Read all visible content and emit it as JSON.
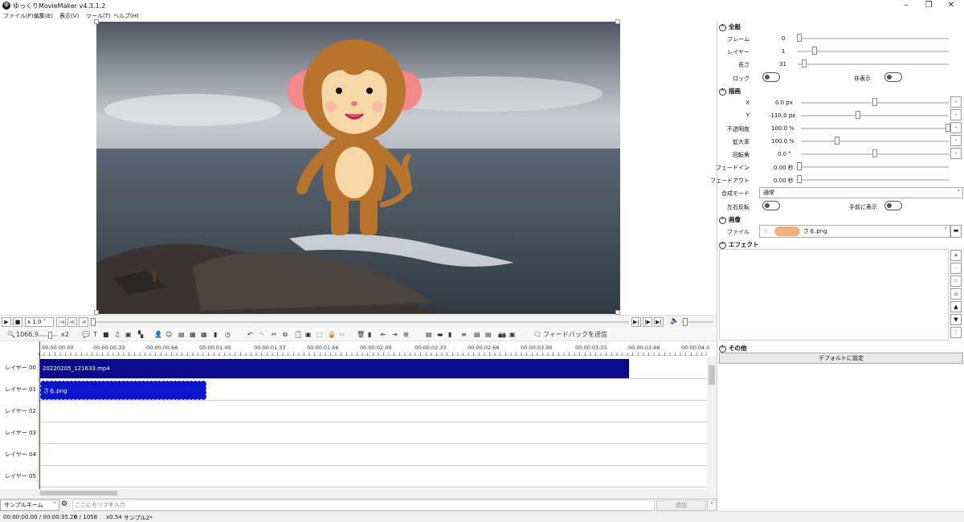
{
  "window": {
    "title": "ゆっくりMovieMaker v4.3.1.2",
    "app_icon": "ゆ"
  },
  "menu": [
    "ファイル(F)",
    "編集(E)",
    "表示(V)",
    "ツール(T)",
    "ヘルプ(H)"
  ],
  "transport": {
    "speed": "x 1.0"
  },
  "toolbar": {
    "zoom": "1066.9",
    "zoom_mult": "x2",
    "feedback": "フィードバックを送信"
  },
  "ruler_ticks": [
    "00:00:00.00",
    "00:00:00.33",
    "00:00:00.66",
    "00:00:01.00",
    "00:00:01.33",
    "00:00:01.66",
    "00:00:02.00",
    "00:00:02.33",
    "00:00:02.66",
    "00:00:03.00",
    "00:00:03.33",
    "00:00:03.66",
    "00:00:04.0"
  ],
  "layers": [
    "レイヤー 00",
    "レイヤー 01",
    "レイヤー 02",
    "レイヤー 03",
    "レイヤー 04",
    "レイヤー 05"
  ],
  "clips": [
    {
      "layer": 0,
      "label": "20220205_121633.mp4",
      "color": "#0a0a8a"
    },
    {
      "layer": 1,
      "label": "さる.png",
      "color": "#0a14c8"
    }
  ],
  "bottom": {
    "speaker": "サンプルネーム",
    "placeholder": "ここにセリフを入力",
    "add": "追加"
  },
  "status": {
    "time": "00:00:00.00  /  00:00:35.26",
    "frame": "0  /  1058",
    "zoom": "x0.54",
    "sample": "サンプル2*"
  },
  "panel": {
    "general": {
      "title": "全般",
      "frame_label": "フレーム",
      "frame_value": "0",
      "layer_label": "レイヤー",
      "layer_value": "1",
      "length_label": "長さ",
      "length_value": "31",
      "lock_label": "ロック",
      "hide_label": "非表示"
    },
    "draw": {
      "title": "描画",
      "rows": [
        {
          "label": "X",
          "value": "0.0 px"
        },
        {
          "label": "Y",
          "value": "-110.0 px"
        },
        {
          "label": "不透明度",
          "value": "100.0 %"
        },
        {
          "label": "拡大率",
          "value": "100.0 %"
        },
        {
          "label": "回転角",
          "value": "0.0 °"
        },
        {
          "label": "フェードイン",
          "value": "0.00 秒"
        },
        {
          "label": "フェードアウト",
          "value": "0.00 秒"
        }
      ],
      "blend_label": "合成モード",
      "blend_value": "通常",
      "flip_label": "左右反転",
      "front_label": "手前に表示"
    },
    "image": {
      "title": "画像",
      "file_label": "ファイル",
      "file_value": "さる.png"
    },
    "effect": {
      "title": "エフェクト"
    },
    "other": {
      "title": "その他",
      "default_button": "デフォルトに設定"
    }
  }
}
